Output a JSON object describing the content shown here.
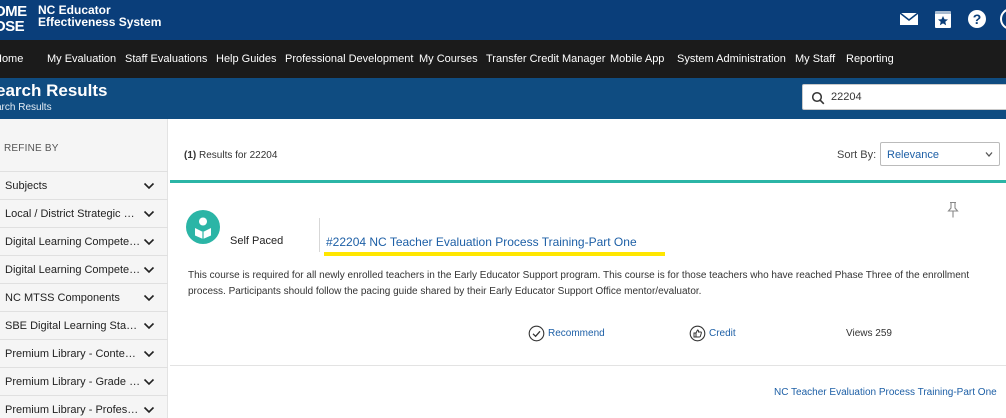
{
  "brand": {
    "logo_line1": "OME",
    "logo_line2": "OSE",
    "title_line1": "NC Educator",
    "title_line2": "Effectiveness System",
    "color_header": "#0a3e7a",
    "color_accent": "#2bb5a6",
    "color_link": "#1d5fa6"
  },
  "header_icons": [
    "mail-icon",
    "star-icon",
    "help-icon",
    "account-icon"
  ],
  "nav": [
    "Home",
    "My Evaluation",
    "Staff Evaluations",
    "Help Guides",
    "Professional Development",
    "My Courses",
    "Transfer Credit Manager",
    "Mobile App",
    "System Administration",
    "My Staff",
    "Reporting"
  ],
  "page_header": {
    "title": "earch Results",
    "breadcrumb": "arch Results"
  },
  "search": {
    "value": "22204"
  },
  "sidebar": {
    "heading": "REFINE BY",
    "facets": [
      "Subjects",
      "Local / District Strategic Plan",
      "Digital Learning Competenci...",
      "Digital Learning Competenci...",
      "NC MTSS Components",
      "SBE Digital Learning Standar...",
      "Premium Library - Content A...",
      "Premium Library - Grade Level",
      "Premium Library - Professio..."
    ]
  },
  "results": {
    "count": "(1)",
    "label": "Results for 22204",
    "sort_label": "Sort By:",
    "sort_value": "Relevance"
  },
  "result": {
    "type": "Self Paced",
    "title": "#22204 NC Teacher Evaluation Process Training-Part One",
    "description": "This course is required for all newly enrolled teachers in the Early Educator Support program.  This course is for those teachers who have reached Phase Three of the enrollment process.  Participants should follow the pacing guide shared by their Early Educator Support Office mentor/evaluator.",
    "recommend": "Recommend",
    "credit": "Credit",
    "views": "Views 259"
  },
  "footer_link": "NC Teacher Evaluation Process Training-Part One"
}
